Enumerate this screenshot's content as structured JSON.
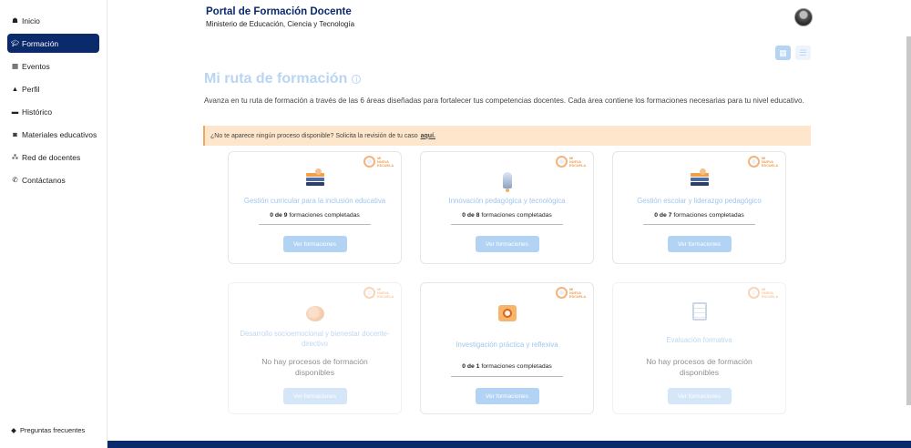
{
  "sidebar": {
    "items": [
      {
        "label": "Inicio",
        "icon": "home-icon"
      },
      {
        "label": "Formación",
        "icon": "graduation-cap-icon",
        "active": true
      },
      {
        "label": "Eventos",
        "icon": "calendar-icon"
      },
      {
        "label": "Perfil",
        "icon": "user-icon"
      },
      {
        "label": "Histórico",
        "icon": "folder-icon"
      },
      {
        "label": "Materiales educativos",
        "icon": "photo-icon"
      },
      {
        "label": "Red de docentes",
        "icon": "network-icon"
      },
      {
        "label": "Contáctanos",
        "icon": "phone-icon"
      }
    ],
    "faq_label": "Preguntas frecuentes"
  },
  "header": {
    "title": "Portal de Formación Docente",
    "subtitle": "Ministerio de Educación, Ciencia y Tecnología"
  },
  "page": {
    "title": "Mi ruta de formación",
    "intro": "Avanza en tu ruta de formación a través de las 6 áreas diseñadas para fortalecer tus competencias docentes. Cada área contiene los formaciones necesarias para tu nivel educativo.",
    "alert_text": "¿No te aparece ningún proceso disponible? Solicita la revisión de tu caso",
    "alert_link": "aquí."
  },
  "badge": {
    "line1": "MI",
    "line2": "NUEVA",
    "line3": "ESCUELA"
  },
  "cards": [
    {
      "title": "Gestión curricular para la inclusión educativa",
      "count": "0 de 9",
      "suffix": "formaciones completadas",
      "button": "Ver formaciones",
      "icon": "books-icon"
    },
    {
      "title": "Innovación pedagógica y tecnológica",
      "count": "0 de 8",
      "suffix": "formaciones completadas",
      "button": "Ver formaciones",
      "icon": "rocket-icon"
    },
    {
      "title": "Gestión escolar y liderazgo pedagógico",
      "count": "0 de 7",
      "suffix": "formaciones completadas",
      "button": "Ver formaciones",
      "icon": "books-icon"
    },
    {
      "title": "Desarrollo socioemocional y bienestar docente-directivo",
      "empty": "No hay procesos de formación disponibles",
      "button": "Ver formaciones",
      "icon": "brain-icon"
    },
    {
      "title": "Investigación práctica y reflexiva",
      "count": "0 de 1",
      "suffix": "formaciones completadas",
      "button": "Ver formaciones",
      "icon": "search-icon"
    },
    {
      "title": "Evaluación formativa",
      "empty": "No hay procesos de formación disponibles",
      "button": "Ver formaciones",
      "icon": "clipboard-icon"
    }
  ]
}
